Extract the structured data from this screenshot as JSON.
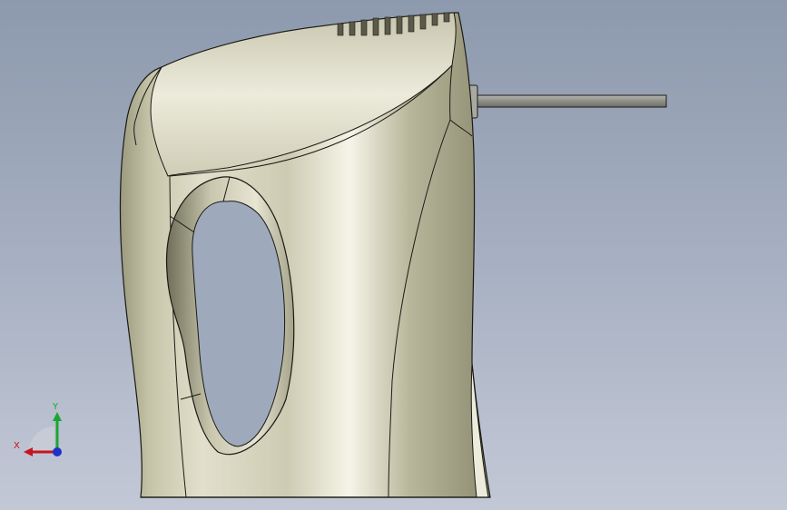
{
  "viewport": {
    "background_top": "#8d99ad",
    "background_bottom": "#c3c8d6"
  },
  "model": {
    "icon": "hand-mixer-body",
    "body_color": "#d8d8bf",
    "shadow_color": "#9c9c7c",
    "outline_color": "#1a1a14",
    "beater_shaft_color": "#8e9088"
  },
  "triad": {
    "x_label": "X",
    "y_label": "Y",
    "x_color": "#c8141e",
    "y_color": "#19a632",
    "z_color": "#1e32c8"
  }
}
